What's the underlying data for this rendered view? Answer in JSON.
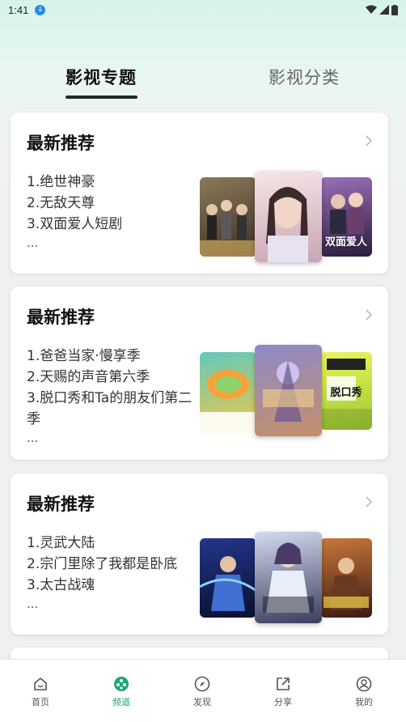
{
  "status_bar": {
    "time": "1:41"
  },
  "top_tabs": [
    {
      "label": "影视专题",
      "active": true
    },
    {
      "label": "影视分类",
      "active": false
    }
  ],
  "cards": [
    {
      "title": "最新推荐",
      "items": [
        "1.绝世神豪",
        "2.无敌天尊",
        "3.双面爱人短剧"
      ],
      "more": "...",
      "posters": [
        {
          "caption": "",
          "colors": [
            "#7a6a4c",
            "#3f2e24"
          ]
        },
        {
          "caption": "",
          "colors": [
            "#f3dde0",
            "#c9a5b3"
          ]
        },
        {
          "caption": "双面\n爱人",
          "colors": [
            "#7a4e9a",
            "#2a1c3c"
          ]
        }
      ]
    },
    {
      "title": "最新推荐",
      "items": [
        "1.爸爸当家·慢享季",
        "2.天赐的声音第六季",
        "3.脱口秀和Ta的朋友们第二季"
      ],
      "more": "...",
      "posters": [
        {
          "caption": "",
          "colors": [
            "#5fc4b8",
            "#f3c845"
          ]
        },
        {
          "caption": "",
          "colors": [
            "#8f89c7",
            "#c48f6a"
          ]
        },
        {
          "caption": "脱口秀",
          "colors": [
            "#e6f05a",
            "#9ac92e"
          ]
        }
      ]
    },
    {
      "title": "最新推荐",
      "items": [
        "1.灵武大陆",
        "2.宗门里除了我都是卧底",
        "3.太古战魂"
      ],
      "more": "...",
      "posters": [
        {
          "caption": "",
          "colors": [
            "#1c2c6c",
            "#0a1030"
          ]
        },
        {
          "caption": "",
          "colors": [
            "#c7d0e8",
            "#3a3d5c"
          ]
        },
        {
          "caption": "",
          "colors": [
            "#c6763a",
            "#3a1a12"
          ]
        }
      ]
    }
  ],
  "bottom_nav": [
    {
      "label": "首页",
      "icon": "home-icon",
      "active": false
    },
    {
      "label": "频道",
      "icon": "film-reel-icon",
      "active": true
    },
    {
      "label": "发现",
      "icon": "compass-icon",
      "active": false
    },
    {
      "label": "分享",
      "icon": "share-icon",
      "active": false
    },
    {
      "label": "我的",
      "icon": "user-icon",
      "active": false
    }
  ],
  "colors": {
    "accent": "#1aa874",
    "tab_underline": "#1f2d2a"
  }
}
